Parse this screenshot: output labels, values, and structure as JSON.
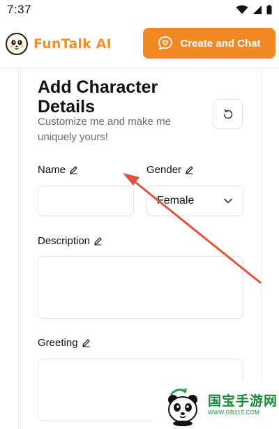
{
  "status_bar": {
    "time": "7:37"
  },
  "header": {
    "brand_name": "FunTalk AI",
    "create_button_label": "Create and Chat"
  },
  "form": {
    "title": "Add Character Details",
    "subtitle": "Customize me and make me uniquely yours!",
    "name": {
      "label": "Name",
      "value": ""
    },
    "gender": {
      "label": "Gender",
      "selected": "Female"
    },
    "description": {
      "label": "Description",
      "value": ""
    },
    "greeting": {
      "label": "Greeting",
      "value": ""
    }
  },
  "watermark": {
    "name": "国宝手游网",
    "url": "WWW.GB315.COM"
  },
  "icons": {
    "status": [
      "wifi-icon",
      "signal-icon",
      "battery-icon"
    ],
    "logo": "panda-face-icon",
    "create": "chat-heart-icon",
    "reset": "refresh-icon",
    "edit": "pencil-icon",
    "dropdown": "chevron-down-icon",
    "annotation": "red-arrow-annotation"
  },
  "colors": {
    "accent": "#f08a24",
    "brand_text": "#f0902a",
    "annotation_arrow": "#e0523e",
    "watermark_green": "#1a8a3a"
  }
}
